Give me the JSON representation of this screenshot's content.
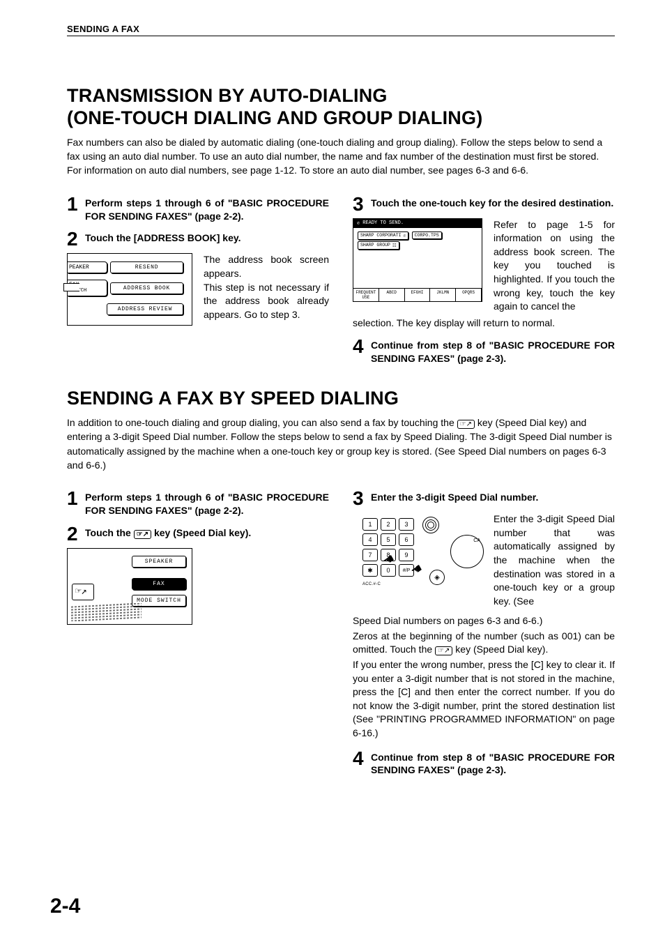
{
  "header": {
    "running": "SENDING A FAX"
  },
  "page_number": "2-4",
  "sectionA": {
    "title_l1": "TRANSMISSION BY AUTO-DIALING",
    "title_l2": " (ONE-TOUCH DIALING AND GROUP DIALING)",
    "intro": "Fax numbers can also be dialed by automatic dialing (one-touch dialing and group dialing). Follow the steps below to send a fax using an auto dial number. To use an auto dial number, the name and fax number of the destination must first be stored. For information on auto dial numbers, see page 1-12. To store an auto dial number, see pages 6-3 and 6-6.",
    "steps": {
      "s1": "Perform steps 1 through 6 of \"BASIC PROCEDURE FOR SENDING FAXES\" (page 2-2).",
      "s2": "Touch the [ADDRESS BOOK] key.",
      "s2_body": "The address book screen appears.\nThis step is not necessary if the address book already appears. Go to step 3.",
      "s3": "Touch the one-touch key for the desired destination.",
      "s3_side": "Refer to page 1-5 for information on using the address book screen.\nThe key you touched is highlighted. If you touch the wrong key, touch the key again to cancel the",
      "s3_after": "selection. The key display will return to normal.",
      "s4": "Continue from step 8 of \"BASIC PROCEDURE FOR SENDING FAXES\" (page 2-3)."
    },
    "fig_ab": {
      "peaker": "PEAKER",
      "resend": "RESEND",
      "fax_switch_l1": "FAX",
      "fax_switch_l2": "SWITCH",
      "address_book": "ADDRESS BOOK",
      "address_review": "ADDRESS REVIEW"
    },
    "fig_ts": {
      "bar": "READY TO SEND.",
      "k1": "SHARP CORPORATI",
      "k2": "CORPO.TPS",
      "k3": "SHARP GROUP",
      "tabs": [
        "FREQUENT USE",
        "ABCD",
        "EFGHI",
        "JKLMN",
        "OPQRS"
      ]
    }
  },
  "sectionB": {
    "title": "SENDING A FAX BY SPEED DIALING",
    "intro_pre": "In addition to one-touch dialing and group dialing, you can also send a fax by touching the ",
    "intro_post": " key (Speed Dial key) and entering a 3-digit Speed Dial number. Follow the steps below to send a fax by Speed Dialing. The 3-digit Speed Dial number is automatically assigned by the machine when a one-touch key or group key is stored. (See Speed Dial numbers on pages 6-3 and 6-6.)",
    "steps": {
      "s1": "Perform steps 1 through 6 of \"BASIC PROCEDURE FOR SENDING FAXES\" (page 2-2).",
      "s2_pre": "Touch the ",
      "s2_post": " key (Speed Dial key).",
      "s3": "Enter the 3-digit Speed Dial number.",
      "s3_side": "Enter the 3-digit Speed Dial number that was automatically assigned by the machine when the destination was stored in a one-touch key or a group key. (See",
      "s3_p1": "Speed Dial numbers on pages 6-3 and 6-6.)",
      "s3_p2_pre": "Zeros at the beginning of the number (such as 001) can be omitted. Touch the ",
      "s3_p2_post": " key (Speed Dial key).",
      "s3_p3": "If you enter the wrong number, press the [C] key to clear it. If you enter a 3-digit number that is not stored in the machine, press the [C] and then enter the correct number. If you do not know the 3-digit number, print the stored destination list (See \"PRINTING PROGRAMMED INFORMATION\" on page 6-16.)",
      "s4": "Continue from step 8 of \"BASIC PROCEDURE FOR SENDING FAXES\" (page 2-3)."
    },
    "fig_sp": {
      "speaker": "SPEAKER",
      "fax": "FAX",
      "mode": "MODE SWITCH"
    },
    "fig_kp": {
      "keys": [
        "1",
        "2",
        "3",
        "4",
        "5",
        "6",
        "7",
        "8",
        "9",
        "✱",
        "0",
        "#/P"
      ],
      "acc": "ACC.#-C",
      "ca": "CA"
    }
  }
}
